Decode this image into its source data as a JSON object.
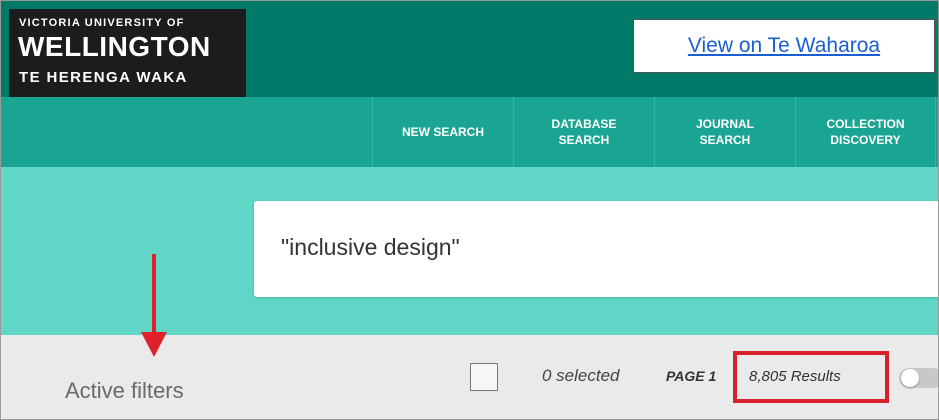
{
  "logo": {
    "line1": "VICTORIA UNIVERSITY OF",
    "line2": "WELLINGTON",
    "line3": "TE HERENGA WAKA"
  },
  "header": {
    "view_link": "View on Te Waharoa"
  },
  "nav": {
    "items": [
      {
        "label": "NEW SEARCH"
      },
      {
        "label": "DATABASE\nSEARCH"
      },
      {
        "label": "JOURNAL\nSEARCH"
      },
      {
        "label": "COLLECTION\nDISCOVERY"
      }
    ]
  },
  "search": {
    "query": "\"inclusive design\""
  },
  "results": {
    "active_filters": "Active filters",
    "selected": "0 selected",
    "page": "PAGE 1",
    "count": "8,805 Results"
  },
  "colors": {
    "header_bg": "#007a68",
    "nav_bg": "#1aa593",
    "search_band_bg": "#5fd6c6",
    "annotation_red": "#d6202a",
    "link_blue": "#1a5fd1"
  }
}
